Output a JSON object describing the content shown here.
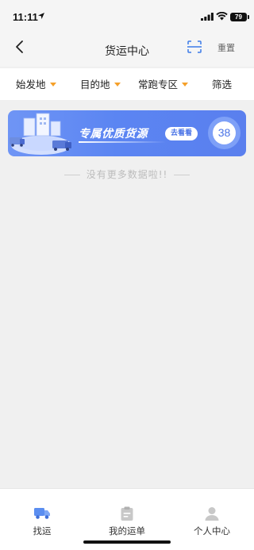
{
  "status_bar": {
    "time": "11:11",
    "battery": "79"
  },
  "nav": {
    "title": "货运中心",
    "reset_label": "重置"
  },
  "filters": [
    {
      "label": "始发地"
    },
    {
      "label": "目的地"
    },
    {
      "label": "常跑专区"
    },
    {
      "label": "筛选"
    }
  ],
  "banner": {
    "title": "专属优质货源",
    "button_label": "去看看",
    "count": "38"
  },
  "list": {
    "empty_text": "没有更多数据啦!!"
  },
  "tabs": [
    {
      "label": "找运",
      "icon": "truck-icon",
      "active": true
    },
    {
      "label": "我的运单",
      "icon": "waybill-icon",
      "active": false
    },
    {
      "label": "个人中心",
      "icon": "person-icon",
      "active": false
    }
  ],
  "colors": {
    "accent": "#4a73e6",
    "filter_caret": "#f5a02a",
    "active_tab_icon": "#5b8ef0",
    "inactive_tab_icon": "#c8c8c8"
  }
}
